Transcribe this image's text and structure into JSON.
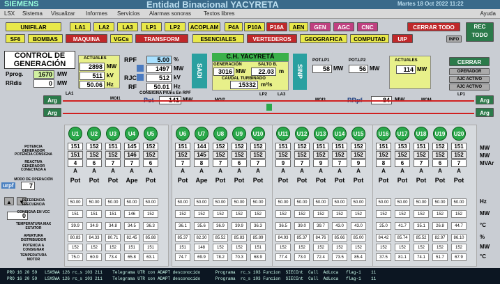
{
  "titlebar": {
    "brand": "SIEMENS",
    "app": "Entidad Binacional YACYRETA",
    "timestamp": "Martes 18 Oct 2022  11:22"
  },
  "menu": [
    "LSX",
    "Sistema",
    "Visualizar",
    "Informes",
    "Servicios",
    "Alarmas sonoras",
    "Textos libres"
  ],
  "menu_help": "Ayuda",
  "toolbar_row1": [
    "UNIFILAR",
    "LA1",
    "LA2",
    "LA3",
    "LP1",
    "LP2",
    "ACOPLAM",
    "P4A",
    "P10A",
    "P16A",
    "AEN",
    "GEN",
    "AGC",
    "CNC",
    "CERRAR TODO"
  ],
  "toolbar_row2": [
    "SF6",
    "BOMBAS",
    "MAQUINA",
    "VGCs",
    "TRANSFORM",
    "ESENCIALES",
    "VERTEDEROS",
    "GEOGRAFICA",
    "COMPUTAD",
    "UIP",
    "INFO"
  ],
  "rec_todo": "REC\nTODO",
  "control": {
    "title": "CONTROL DE GENERACIÓN",
    "pprog_label": "Pprog.",
    "pprog_value": "1670",
    "pprog_unit": "MW",
    "rrdis_label": "RRdis",
    "rrdis_value": "0",
    "rrdis_unit": "MW",
    "actuales_label": "ACTUALES",
    "act1": "2898",
    "act1u": "MW",
    "act2": "511",
    "act2u": "kV",
    "act3": "50.06",
    "act3u": "Hz",
    "rpf_label": "RPF",
    "rpf_value": "5.00",
    "rpf_unit": "%",
    "v2": "1497",
    "v2u": "MW",
    "rjc_label": "RJC",
    "rjc_value": "512",
    "rjc_unit": "kV",
    "rf_label": "RF",
    "rf_value": "50.01",
    "rf_unit": "Hz",
    "sadi": "SADI",
    "ch_title": "C.H. YACYRETÁ",
    "gen_label": "GENERACIÓN",
    "salto_label": "SALTO B.",
    "gen_value": "3016",
    "gen_unit": "MW",
    "salto_value": "22.03",
    "salto_unit": "m",
    "caudal_label": "CAUDAL TURBINADO",
    "caudal_value": "15332",
    "caudal_unit": "m³/s",
    "sinp": "SINP",
    "potlp1_label": "POT.LP1",
    "potlp1_value": "58",
    "potlp1_unit": "MW",
    "potlp2_label": "POT.LP2",
    "potlp2_value": "56",
    "potlp2_unit": "MW",
    "act_right_label": "ACTUALES",
    "act_right_value": "114",
    "act_right_unit": "MW",
    "cerrar": "CERRAR",
    "operador": "OPERADOR",
    "ajc1": "AJC ACTIVO",
    "ajc2": "AJC ACTIVO"
  },
  "busbar": {
    "arg1": "Arg",
    "arg2": "Arg",
    "arg3": "Arg",
    "arg4": "Arg",
    "la1": "LA1",
    "la2": "LA2",
    "la3": "LA3",
    "lp1": "LP1",
    "lp2": "LP2",
    "moi1": "MOI1",
    "moi2": "MOI2",
    "moi3": "MOI3",
    "moi4": "MOI4",
    "consigna_label": "CONSIGNA P/Uns En RPF",
    "pot_label": "Pot",
    "pot_value": "141",
    "pot_unit": "MW",
    "rrpf_label": "RRpf",
    "rrpf_value": "84",
    "rrpf_unit": "MW"
  },
  "units": [
    "U1",
    "U2",
    "U3",
    "U4",
    "U5",
    "U6",
    "U7",
    "U8",
    "U9",
    "U10",
    "U11",
    "U12",
    "U13",
    "U14",
    "U15",
    "U16",
    "U17",
    "U18",
    "U19",
    "U20"
  ],
  "rows": {
    "potencia_label": "POTENCIA GENERADOR",
    "potencia": [
      "151",
      "152",
      "151",
      "145",
      "152",
      "151",
      "144",
      "152",
      "152",
      "152",
      "151",
      "152",
      "151",
      "151",
      "152",
      "151",
      "153",
      "151",
      "152",
      "151"
    ],
    "consigna_label": "POTENCIA CONSIGNA",
    "consigna": [
      "151",
      "152",
      "152",
      "146",
      "152",
      "152",
      "145",
      "152",
      "152",
      "152",
      "152",
      "152",
      "152",
      "152",
      "152",
      "152",
      "152",
      "152",
      "152",
      "152"
    ],
    "reactiva_label": "REACTIVA GENERADOR",
    "reactiva": [
      "4",
      "6",
      "7",
      "7",
      "6",
      "7",
      "8",
      "7",
      "6",
      "7",
      "9",
      "7",
      "9",
      "7",
      "9",
      "8",
      "6",
      "7",
      "6",
      "7"
    ],
    "conectada_label": "CONECTADA A",
    "conectada": [
      "A",
      "A",
      "A",
      "A",
      "A",
      "A",
      "A",
      "A",
      "A",
      "A",
      "A",
      "A",
      "A",
      "A",
      "A",
      "A",
      "A",
      "A",
      "A",
      "A"
    ],
    "modo_label": "MODO DE OPERACIÓN",
    "modo": [
      "Pot",
      "Pot",
      "Pot",
      "Ape",
      "Pot",
      "Pot",
      "Ape",
      "Pot",
      "Pot",
      "Pot",
      "Pot",
      "Pot",
      "Pot",
      "Pot",
      "Pot",
      "Pot",
      "Pot",
      "Pot",
      "Pot",
      "Pot"
    ],
    "referencia_label": "REFERENCIA FRECUENCIA",
    "referencia": [
      "50.00",
      "50.00",
      "50.00",
      "50.00",
      "50.00",
      "50.00",
      "50.00",
      "50.00",
      "50.00",
      "50.00",
      "50.00",
      "50.00",
      "50.00",
      "50.00",
      "50.00",
      "50.00",
      "50.00",
      "50.00",
      "50.00",
      "50.00"
    ],
    "consvcc_label": "CONSIGNA EN VCC",
    "consvcc": [
      "151",
      "151",
      "151",
      "146",
      "152",
      "152",
      "152",
      "152",
      "152",
      "152",
      "152",
      "152",
      "152",
      "152",
      "152",
      "152",
      "152",
      "152",
      "152",
      "152"
    ],
    "temp_label": "TEMPERATURA MAX ESTATOR",
    "temp": [
      "39.9",
      "34.9",
      "34.8",
      "34.5",
      "36.3",
      "36.1",
      "35.6",
      "36.9",
      "39.9",
      "36.3",
      "36.5",
      "39.0",
      "39.7",
      "43.0",
      "43.0",
      "25.0",
      "41.7",
      "35.1",
      "26.8",
      "44.7"
    ],
    "apertura_label": "APERTURA DISTRIBUIDOR",
    "apertura": [
      "80.83",
      "84.33",
      "80.71",
      "82.45",
      "85.88",
      "85.37",
      "82.30",
      "85.52",
      "85.83",
      "85.89",
      "84.93",
      "85.37",
      "84.76",
      "85.66",
      "85.00",
      "84.42",
      "85.74",
      "85.52",
      "82.97",
      "86.10"
    ],
    "potcons_label": "POTENCIA A CONSIGNAR",
    "potcons": [
      "152",
      "152",
      "152",
      "151",
      "151",
      "151",
      "148",
      "152",
      "152",
      "151",
      "152",
      "152",
      "152",
      "152",
      "152",
      "152",
      "152",
      "152",
      "152",
      "152"
    ],
    "tempmotor_label": "TEMPERATURA MOTOR",
    "tempmotor": [
      "75.0",
      "60.9",
      "73.4",
      "65.8",
      "63.1",
      "74.7",
      "69.9",
      "78.2",
      "70.3",
      "68.9",
      "77.4",
      "73.0",
      "72.4",
      "73.5",
      "85.4",
      "37.5",
      "81.1",
      "74.1",
      "51.7",
      "67.9"
    ],
    "units_right": [
      "MW",
      "MW",
      "MVAr",
      "",
      "",
      "Hz",
      "MW",
      "°C",
      "%",
      "MW",
      "°C"
    ]
  },
  "freq_side": {
    "urpf": "urpf",
    "urpf_value": "7",
    "zero": "0"
  },
  "status_lines": [
    "PRO 16 20 59   LSXSWA 126 rc_s 103 211    Telegrama UTR con ADAPT desconocido      Programa  rc_s 103 Funcion  SIECInt  Call  AdLoca   flag-1    11",
    "PRO 16 20 59   LSXSWA 126 rc_s 103 211    Telegrama UTR con ADAPT desconocido      Programa  rc_s 103 Funcion  SIECInt  Call  AdLoca   flag-1    11"
  ]
}
